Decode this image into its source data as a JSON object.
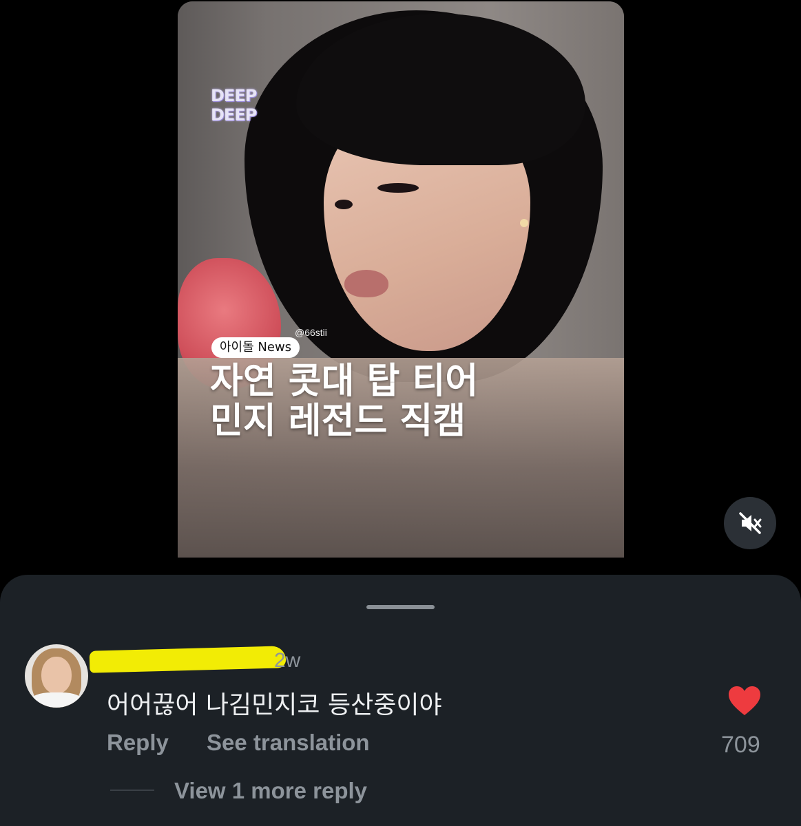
{
  "video": {
    "logo_text": "DEEP DEEP",
    "handle": "@66stii",
    "badge": "아이돌 News",
    "headline_line1": "자연 콧대 탑 티어",
    "headline_line2": "민지 레전드 직캠",
    "mute_icon": "speaker-muted-icon"
  },
  "comment": {
    "age": "2w",
    "text": "어어끊어 나김민지코 등산중이야",
    "reply_label": "Reply",
    "translate_label": "See translation",
    "like_count": "709",
    "view_more_label": "View 1 more reply"
  },
  "colors": {
    "background": "#000000",
    "sheet": "#1c2126",
    "muted_text": "#8d949b",
    "heart": "#ee3b3f",
    "redaction": "#f2ec05"
  }
}
